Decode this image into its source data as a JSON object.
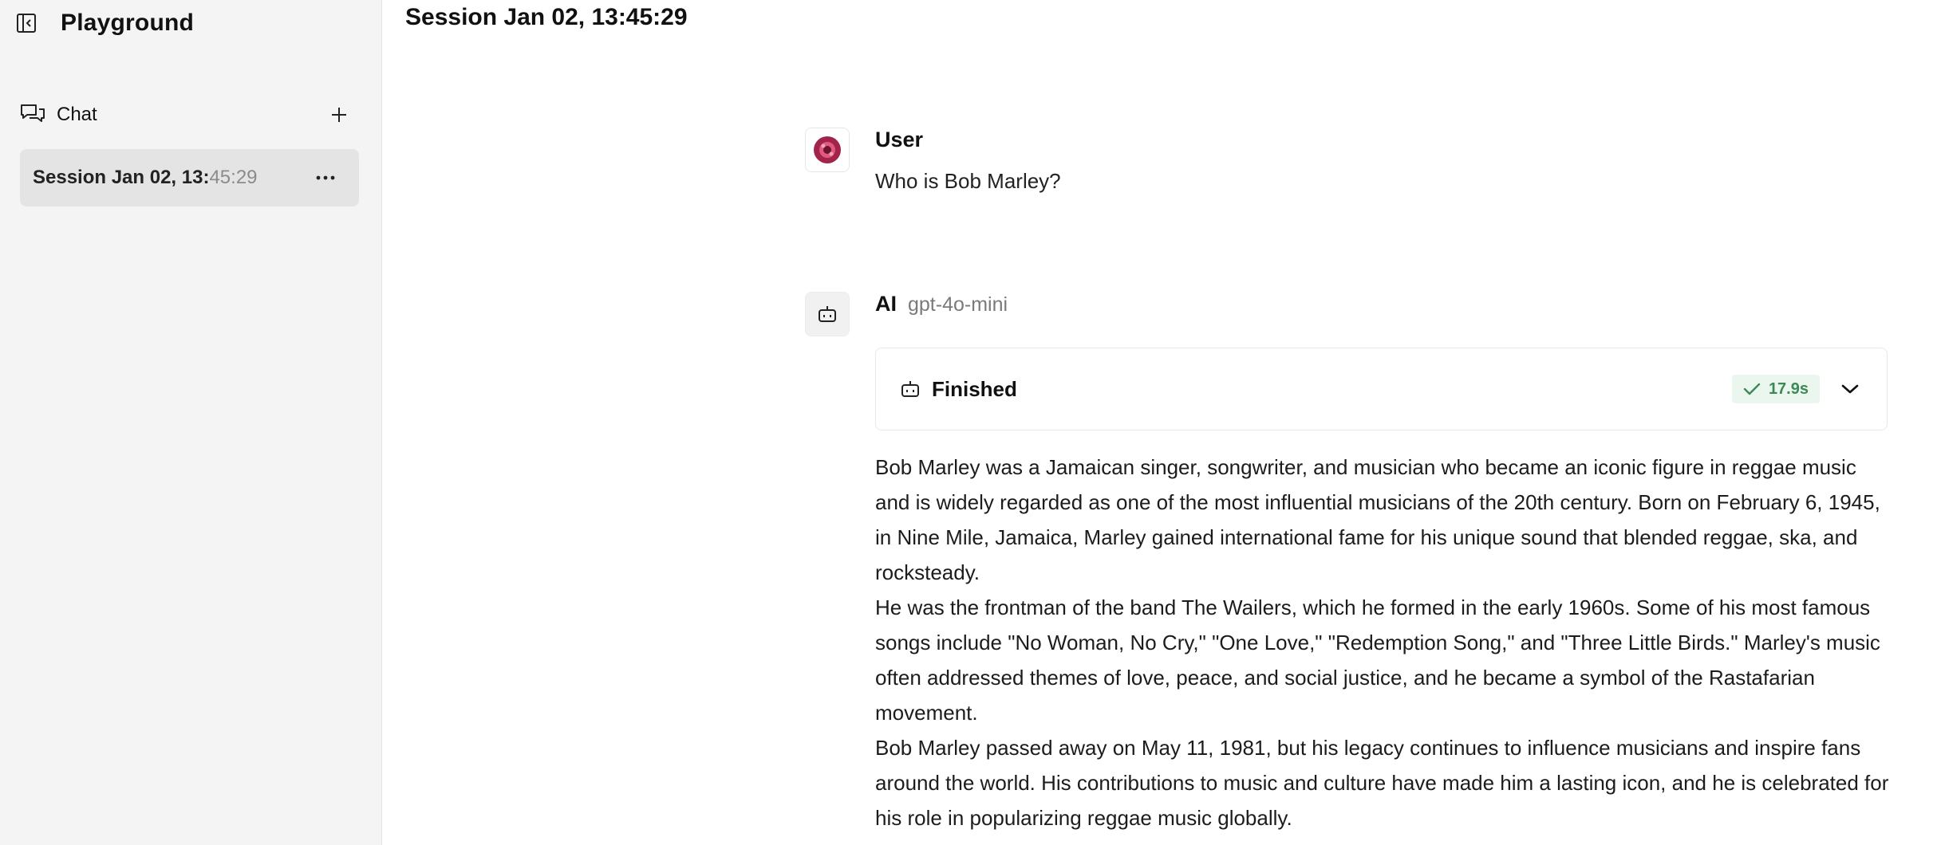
{
  "sidebar": {
    "app_title": "Playground",
    "collapse_icon": "sidebar-collapse-icon",
    "chat_label": "Chat",
    "sessions": [
      {
        "label_main": "Session Jan 02, 13:",
        "label_fade": "45:29"
      }
    ]
  },
  "main": {
    "title": "Session Jan 02, 13:45:29",
    "messages": {
      "user": {
        "name": "User",
        "text": "Who is Bob Marley?"
      },
      "ai": {
        "name": "AI",
        "model": "gpt-4o-mini",
        "status": "Finished",
        "duration": "17.9s",
        "paragraphs": [
          "Bob Marley was a Jamaican singer, songwriter, and musician who became an iconic figure in reggae music and is widely regarded as one of the most influential musicians of the 20th century. Born on February 6, 1945, in Nine Mile, Jamaica, Marley gained international fame for his unique sound that blended reggae, ska, and rocksteady.",
          "He was the frontman of the band The Wailers, which he formed in the early 1960s. Some of his most famous songs include \"No Woman, No Cry,\" \"One Love,\" \"Redemption Song,\" and \"Three Little Birds.\" Marley's music often addressed themes of love, peace, and social justice, and he became a symbol of the Rastafarian movement.",
          "Bob Marley passed away on May 11, 1981, but his legacy continues to influence musicians and inspire fans around the world. His contributions to music and culture have made him a lasting icon, and he is celebrated for his role in popularizing reggae music globally."
        ]
      }
    }
  },
  "colors": {
    "badge_bg": "#eaf6ee",
    "badge_fg": "#3b8a55",
    "sidebar_bg": "#f4f4f4",
    "selected_bg": "#e4e4e4"
  }
}
